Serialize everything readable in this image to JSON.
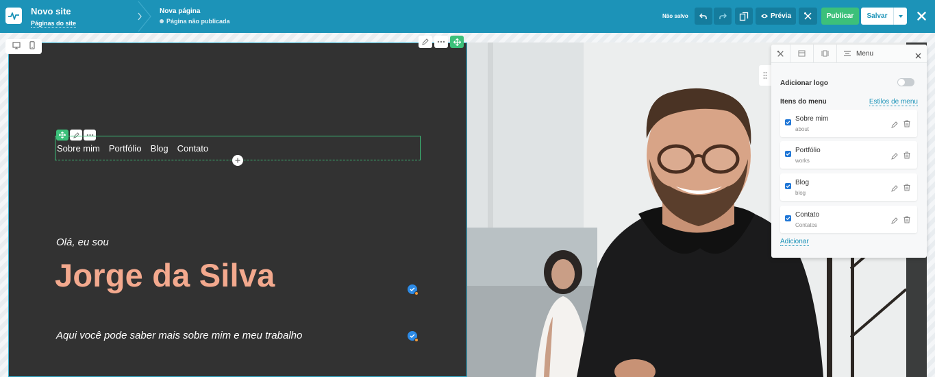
{
  "header": {
    "site_title": "Novo site",
    "site_pages_link": "Páginas do site",
    "page_name": "Nova página",
    "page_status": "Página não publicada",
    "save_status": "Não salvo",
    "preview_label": "Prévia",
    "publish_label": "Publicar",
    "save_label": "Salvar"
  },
  "site": {
    "nav": [
      "Sobre mim",
      "Portfólio",
      "Blog",
      "Contato"
    ],
    "hello": "Olá, eu sou",
    "name": "Jorge da Silva",
    "subtitle": "Aqui você pode saber mais sobre mim e meu trabalho",
    "name_color": "#f3a98e"
  },
  "menu_panel": {
    "title": "Menu",
    "add_logo_label": "Adicionar logo",
    "add_logo_enabled": false,
    "items_label": "Itens do menu",
    "styles_link": "Estilos de menu",
    "items": [
      {
        "label": "Sobre mim",
        "slug": "about"
      },
      {
        "label": "Portfólio",
        "slug": "works"
      },
      {
        "label": "Blog",
        "slug": "blog"
      },
      {
        "label": "Contato",
        "slug": "Contatos"
      }
    ],
    "add_link": "Adicionar"
  },
  "colors": {
    "topbar": "#1c93b8",
    "publish": "#3cc07a",
    "selection": "#3cc07a",
    "canvas_dark": "#323232"
  }
}
